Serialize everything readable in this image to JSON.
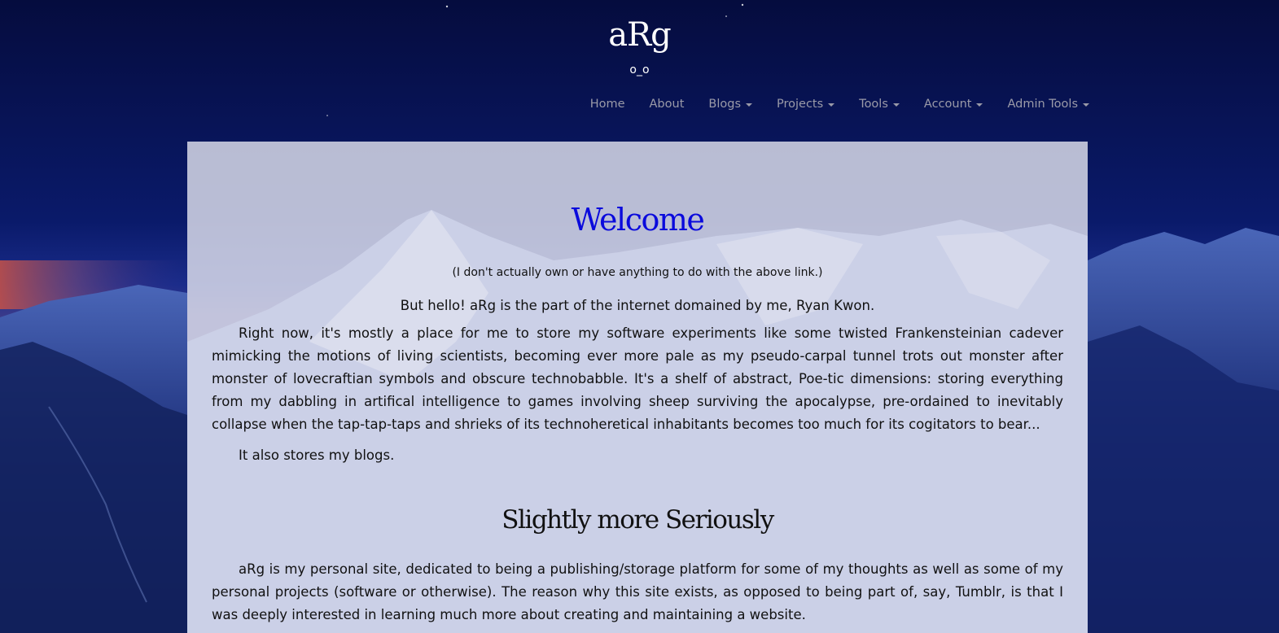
{
  "site": {
    "title": "aRg",
    "subtitle": "o_o"
  },
  "nav": {
    "items": [
      {
        "label": "Home",
        "dropdown": false
      },
      {
        "label": "About",
        "dropdown": false
      },
      {
        "label": "Blogs",
        "dropdown": true
      },
      {
        "label": "Projects",
        "dropdown": true
      },
      {
        "label": "Tools",
        "dropdown": true
      },
      {
        "label": "Account",
        "dropdown": true
      },
      {
        "label": "Admin Tools",
        "dropdown": true
      }
    ]
  },
  "main": {
    "welcome_title": "Welcome",
    "disclaimer": "(I don't actually own or have anything to do with the above link.)",
    "hello": "But hello! aRg is the part of the internet domained by me, Ryan Kwon.",
    "intro_paragraph": "Right now, it's mostly a place for me to store my software experiments like some twisted Frankensteinian cadever mimicking the motions of living scientists, becoming ever more pale as my pseudo-carpal tunnel trots out monster after monster of lovecraftian symbols and obscure technobabble. It's a shelf of abstract, Poe-tic dimensions: storing everything from my dabbling in artifical intelligence to games involving sheep surviving the apocalypse, pre-ordained to inevitably collapse when the tap-tap-taps and shrieks of its technoheretical inhabitants becomes too much for its cogitators to bear...",
    "blogs_line": "It also stores my blogs.",
    "serious_title": "Slightly more Seriously",
    "serious_paragraph": "aRg is my personal site, dedicated to being a publishing/storage platform for some of my thoughts as well as some of my personal projects (software or otherwise). The reason why this site exists, as opposed to being part of, say, Tumblr, is that I was deeply interested in learning much more about creating and maintaining a website."
  },
  "colors": {
    "sky_top": "#06104a",
    "welcome_title": "#0a0adc",
    "nav_text": "#9a9aa8"
  }
}
